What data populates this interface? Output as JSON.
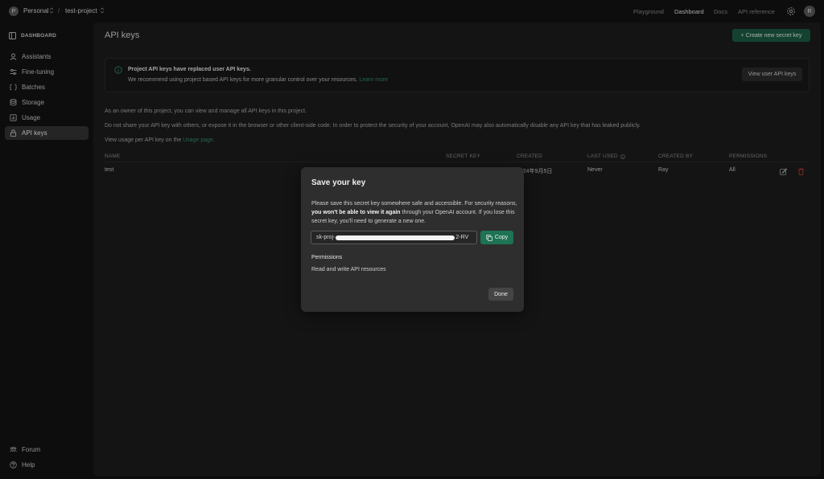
{
  "topbar": {
    "org_initial": "P",
    "org_name": "Personal",
    "project_name": "test-project",
    "nav": [
      "Playground",
      "Dashboard",
      "Docs",
      "API reference"
    ],
    "active_nav": "Dashboard",
    "user_initial": "R"
  },
  "sidebar": {
    "heading": "DASHBOARD",
    "items": [
      {
        "label": "Assistants",
        "icon": "assistant-icon"
      },
      {
        "label": "Fine-tuning",
        "icon": "tune-icon"
      },
      {
        "label": "Batches",
        "icon": "batches-icon"
      },
      {
        "label": "Storage",
        "icon": "storage-icon"
      },
      {
        "label": "Usage",
        "icon": "usage-icon"
      },
      {
        "label": "API keys",
        "icon": "lock-icon",
        "active": true
      }
    ],
    "footer": [
      {
        "label": "Forum",
        "icon": "forum-icon"
      },
      {
        "label": "Help",
        "icon": "help-icon"
      }
    ]
  },
  "main": {
    "title": "API keys",
    "create_button": "+ Create new secret key",
    "notice": {
      "title": "Project API keys have replaced user API keys.",
      "text": "We recommend using project based API keys for more granular control over your resources.",
      "link": "Learn more",
      "button": "View user API keys"
    },
    "paragraphs": [
      "As an owner of this project, you can view and manage all API keys in this project.",
      "Do not share your API key with others, or expose it in the browser or other client-side code. In order to protect the security of your account, OpenAI may also automatically disable any API key that has leaked publicly."
    ],
    "usage_text": "View usage per API key on the",
    "usage_link": "Usage page",
    "usage_end": ".",
    "table": {
      "headers": [
        "NAME",
        "SECRET KEY",
        "CREATED",
        "LAST USED",
        "CREATED BY",
        "PERMISSIONS"
      ],
      "rows": [
        {
          "name": "test",
          "created": "2024年9月5日",
          "last_used": "Never",
          "created_by": "Ray",
          "permissions": "All"
        }
      ]
    }
  },
  "modal": {
    "title": "Save your key",
    "desc_1": "Please save this secret key somewhere safe and accessible. For security reasons, ",
    "desc_bold": "you won't be able to view it again",
    "desc_2": " through your OpenAI account. If you lose this secret key, you'll need to generate a new one.",
    "key_prefix": "sk-proj-",
    "key_suffix": "2-RV",
    "copy_button": "Copy",
    "permissions_label": "Permissions",
    "permissions_value": "Read and write API resources",
    "done_button": "Done"
  },
  "colors": {
    "accent_green": "#1d7353",
    "link_green": "#2e8f66",
    "delete_red": "#c0392b"
  }
}
